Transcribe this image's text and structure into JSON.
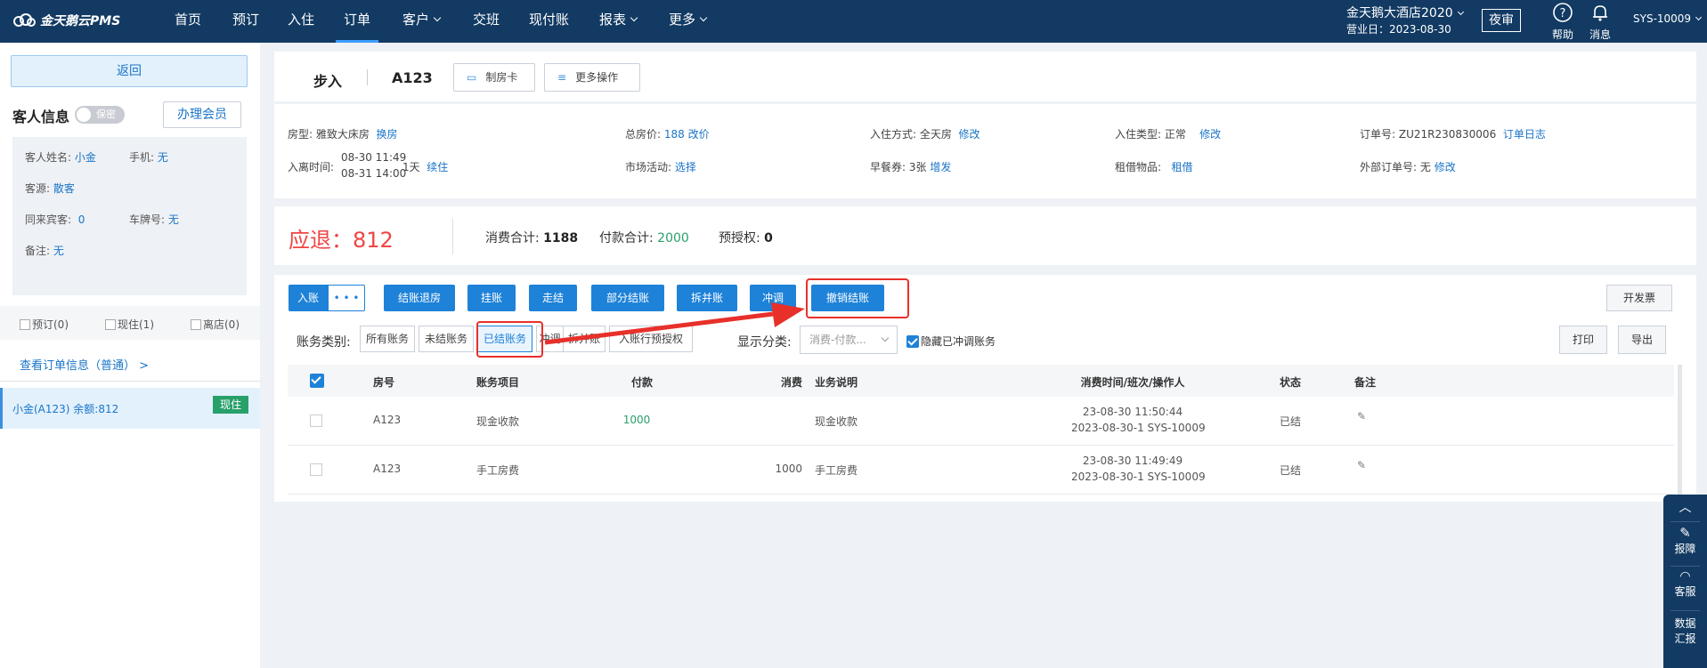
{
  "nav": {
    "brand": "金天鹅云PMS",
    "items": [
      {
        "label": "首页",
        "dropdown": false
      },
      {
        "label": "预订",
        "dropdown": false
      },
      {
        "label": "入住",
        "dropdown": false
      },
      {
        "label": "订单",
        "dropdown": false,
        "active": true
      },
      {
        "label": "客户",
        "dropdown": true
      },
      {
        "label": "交班",
        "dropdown": false
      },
      {
        "label": "现付账",
        "dropdown": false
      },
      {
        "label": "报表",
        "dropdown": true
      },
      {
        "label": "更多",
        "dropdown": true
      }
    ],
    "hotel": "金天鹅大酒店2020",
    "business_date": "营业日：2023-08-30",
    "night_audit": "夜审",
    "help": "帮助",
    "message": "消息",
    "user": "SYS-10009"
  },
  "left": {
    "back": "返回",
    "guest_title": "客人信息",
    "privacy_toggle": "保密",
    "member_button": "办理会员",
    "guest": {
      "name_label": "客人姓名:",
      "name": "小金",
      "phone_label": "手机:",
      "phone": "无",
      "source_label": "客源:",
      "source": "散客",
      "companion_label": "同来宾客:",
      "companion": "0",
      "plate_label": "车牌号:",
      "plate": "无",
      "note_label": "备注:",
      "note": "无"
    },
    "filters": [
      "预订(0)",
      "现住(1)",
      "离店(0)"
    ],
    "view_order": "查看订单信息（普通） >",
    "room_item": "小金(A123)  余额:812",
    "room_badge": "现住"
  },
  "order": {
    "status": "步入",
    "room": "A123",
    "make_card": "制房卡",
    "more_ops": "更多操作"
  },
  "info": {
    "room_type_label": "房型:",
    "room_type": "雅致大床房",
    "change_room": "换房",
    "total_price_label": "总房价:",
    "total_price": "188",
    "change_price": "改价",
    "checkin_mode_label": "入住方式:",
    "checkin_mode": "全天房",
    "checkin_mode_edit": "修改",
    "checkin_type_label": "入住类型:",
    "checkin_type": "正常",
    "checkin_type_edit": "修改",
    "order_no_label": "订单号:",
    "order_no": "ZU21R230830006",
    "order_log": "订单日志",
    "stay_label": "入离时间:",
    "stay_in": "08-30 11:49",
    "stay_out": "08-31 14:00",
    "nights": "1天",
    "extend": "续住",
    "market_label": "市场活动:",
    "market": "选择",
    "breakfast_label": "早餐券:",
    "breakfast": "3张",
    "breakfast_add": "增发",
    "rental_label": "租借物品:",
    "rental": "租借",
    "ext_order_label": "外部订单号:",
    "ext_order": "无",
    "ext_order_edit": "修改"
  },
  "summary": {
    "refund": "应退：812",
    "consume_label": "消费合计:",
    "consume": "1188",
    "payment_label": "付款合计:",
    "payment": "2000",
    "preauth_label": "预授权:",
    "preauth": "0"
  },
  "actions": {
    "post": "入账",
    "more": "• • •",
    "checkout_refund": "结账退房",
    "hang": "挂账",
    "walk": "走结",
    "partial": "部分结账",
    "split": "拆并账",
    "adjust": "冲调",
    "cancel_settle": "撤销结账",
    "invoice": "开发票",
    "print": "打印",
    "export": "导出"
  },
  "filters": {
    "category_label": "账务类别:",
    "segments": [
      "所有账务",
      "未结账务",
      "已结账务",
      "冲调",
      "拆并账",
      "入账行预授权"
    ],
    "selected": "已结账务",
    "display_label": "显示分类:",
    "display_value": "消费-付款...",
    "hide_adjust": "隐藏已冲调账务"
  },
  "table": {
    "headers": [
      "房号",
      "账务项目",
      "付款",
      "消费",
      "业务说明",
      "消费时间/班次/操作人",
      "状态",
      "备注"
    ],
    "rows": [
      {
        "room": "A123",
        "item": "现金收款",
        "payment": "1000",
        "consume": "",
        "desc": "现金收款",
        "time": "23-08-30 11:50:44",
        "shift": "2023-08-30-1 SYS-10009",
        "status": "已结"
      },
      {
        "room": "A123",
        "item": "手工房费",
        "payment": "",
        "consume": "1000",
        "desc": "手工房费",
        "time": "23-08-30 11:49:49",
        "shift": "2023-08-30-1 SYS-10009",
        "status": "已结"
      }
    ]
  },
  "float_menu": {
    "report": "报障",
    "service": "客服",
    "data_line1": "数据",
    "data_line2": "汇报"
  },
  "colors": {
    "nav_bg": "#123a63",
    "primary": "#1e82d8",
    "refund_red": "#f04444",
    "green": "#27a06a",
    "annotation_red": "#e8302a"
  }
}
